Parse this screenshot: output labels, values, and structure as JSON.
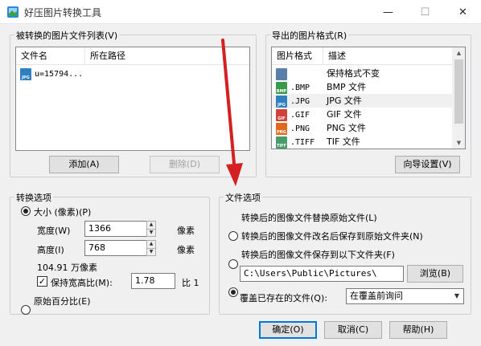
{
  "window": {
    "title": "好压图片转换工具",
    "minimize": "—",
    "maximize": "☐",
    "close": "✕"
  },
  "file_list": {
    "group_title": "被转换的图片文件列表(V)",
    "columns": [
      "文件名",
      "所在路径"
    ],
    "rows": [
      {
        "icon_label": "JPG",
        "name": "u=15794...",
        "path": ""
      }
    ],
    "add_button": "添加(A)",
    "delete_button": "删除(D)"
  },
  "export_format": {
    "group_title": "导出的图片格式(R)",
    "columns": [
      "图片格式",
      "描述"
    ],
    "rows": [
      {
        "icon": "keep",
        "icon_label": "",
        "format": "",
        "desc": "保持格式不变",
        "color": "#5a7fa8"
      },
      {
        "icon": "bmp",
        "icon_label": "BMP",
        "format": ".BMP",
        "desc": "BMP 文件",
        "color": "#3b9a4a"
      },
      {
        "icon": "jpg",
        "icon_label": "JPG",
        "format": ".JPG",
        "desc": "JPG 文件",
        "color": "#2f7fc1"
      },
      {
        "icon": "gif",
        "icon_label": "GIF",
        "format": ".GIF",
        "desc": "GIF 文件",
        "color": "#d0433a"
      },
      {
        "icon": "png",
        "icon_label": "PNG",
        "format": ".PNG",
        "desc": "PNG 文件",
        "color": "#e06a1c"
      },
      {
        "icon": "tiff",
        "icon_label": "TIFF",
        "format": ".TIFF",
        "desc": "TIF 文件",
        "color": "#4a9b6a"
      }
    ],
    "selected_index": 2,
    "wizard_button": "向导设置(V)"
  },
  "convert_options": {
    "group_title": "转换选项",
    "size_radio": "大小 (像素)(P)",
    "width_label": "宽度(W)",
    "width_value": "1366",
    "width_unit": "像素",
    "height_label": "高度(I)",
    "height_value": "768",
    "height_unit": "像素",
    "megapixels": "104.91 万像素",
    "keep_ratio_label": "保持宽高比(M):",
    "ratio_value": "1.78",
    "ratio_suffix": "比 1",
    "percent_radio": "原始百分比(E)"
  },
  "file_options": {
    "group_title": "文件选项",
    "option_replace": "转换后的图像文件替换原始文件(L)",
    "option_rename": "转换后的图像文件改名后保存到原始文件夹(N)",
    "option_save_to": "转换后的图像文件保存到以下文件夹(F)",
    "folder_path": "C:\\Users\\Public\\Pictures\\",
    "browse_button": "浏览(B)",
    "overwrite_label": "覆盖已存在的文件(Q):",
    "overwrite_value": "在覆盖前询问"
  },
  "footer": {
    "ok_button": "确定(O)",
    "cancel_button": "取消(C)",
    "help_button": "帮助(H)"
  },
  "accent_color": "#0078d7",
  "annotation_arrow_color": "#d42020"
}
